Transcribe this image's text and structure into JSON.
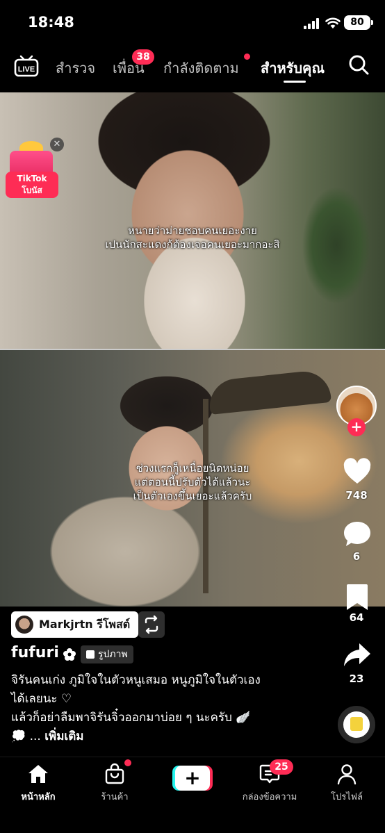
{
  "status_bar": {
    "time": "18:48",
    "battery": "80"
  },
  "top_nav": {
    "tabs": [
      {
        "label": "สำรวจ"
      },
      {
        "label": "เพื่อน",
        "badge": "38"
      },
      {
        "label": "กำลังติดตาม"
      },
      {
        "label": "สำหรับคุณ",
        "active": true
      }
    ]
  },
  "gift_badge": {
    "line1": "TikTok",
    "line2": "โบนัส"
  },
  "captions": {
    "top": [
      "หนายว่าม่ายชอบคนเยอะงาย",
      "เปนนักสะแดงก้ต้องเจอคนเยอะมากอะสิ"
    ],
    "bottom": [
      "ช่วงแรกกู็เหนื่อยนิดหน่อย",
      "แต่ตอนนี้ปรับตัวได้แล้วนะ",
      "เป็นตัวเองขึ้นเยอะแล้วครับ"
    ]
  },
  "right_rail": {
    "likes": "748",
    "comments": "6",
    "saves": "64",
    "shares": "23"
  },
  "post": {
    "repost_label": "Markjrtn รีโพสต์",
    "username": "fufuri",
    "type_label": "รูปภาพ",
    "description_lines": [
      "จิรันคนเก่ง ภูมิใจในตัวหนูเสมอ หนูภูมิใจในตัวเอง",
      "ได้เลยนะ ♡",
      "แล้วก็อย่าลืมพาจิรันจิ๋วออกมาบ่อย ๆ นะครับ 🪽",
      "💭 ..."
    ],
    "more_label": "เพิ่มเติม"
  },
  "tab_bar": {
    "items": [
      {
        "label": "หน้าหลัก",
        "active": true
      },
      {
        "label": "ร้านค้า"
      },
      {
        "label": ""
      },
      {
        "label": "กล่องข้อความ",
        "badge": "25"
      },
      {
        "label": "โปรไฟล์"
      }
    ]
  },
  "colors": {
    "accent": "#fe2c55",
    "cyan": "#25f4ee",
    "background": "#000000"
  }
}
